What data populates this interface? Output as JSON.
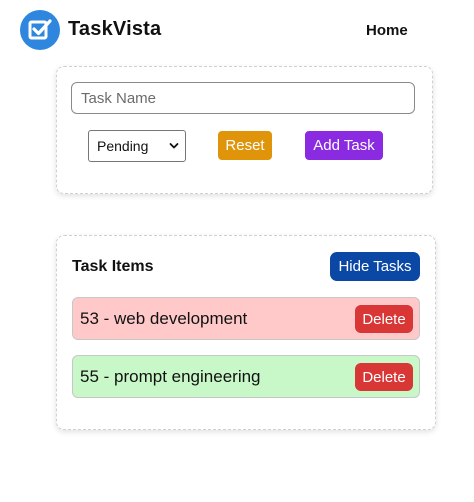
{
  "header": {
    "brand": "TaskVista",
    "nav_home": "Home"
  },
  "form": {
    "input_placeholder": "Task Name",
    "input_value": "",
    "status_selected": "Pending",
    "reset_label": "Reset",
    "add_label": "Add Task"
  },
  "list": {
    "title": "Task Items",
    "hide_label": "Hide Tasks",
    "items": [
      {
        "text": "53 - web development",
        "status": "pending",
        "delete_label": "Delete"
      },
      {
        "text": "55 - prompt engineering",
        "status": "done",
        "delete_label": "Delete"
      }
    ]
  },
  "colors": {
    "logo": "#2e86de",
    "reset": "#e0940a",
    "add": "#8a2be2",
    "hide": "#0b47a5",
    "delete": "#d93636",
    "pending_bg": "#ffc9c9",
    "done_bg": "#c8f8c8"
  }
}
